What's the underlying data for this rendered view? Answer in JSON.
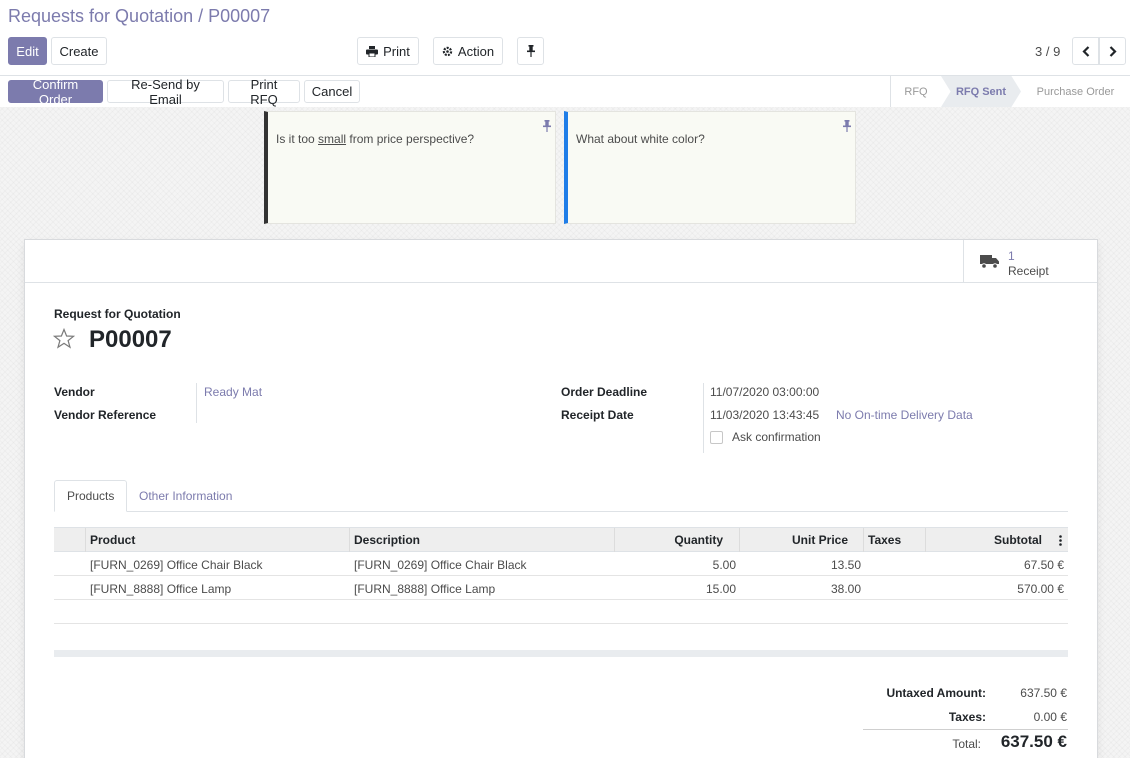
{
  "breadcrumb": {
    "parent": "Requests for Quotation",
    "separator": " / ",
    "current": "P00007"
  },
  "toolbar": {
    "edit": "Edit",
    "create": "Create",
    "print": "Print",
    "action": "Action"
  },
  "pager": {
    "value": "3 / 9"
  },
  "status_buttons": {
    "confirm": "Confirm Order",
    "resend": "Re-Send by Email",
    "print_rfq": "Print RFQ",
    "cancel": "Cancel"
  },
  "stages": [
    {
      "label": "RFQ",
      "active": false
    },
    {
      "label": "RFQ Sent",
      "active": true
    },
    {
      "label": "Purchase Order",
      "active": false
    }
  ],
  "notes": [
    {
      "before": "Is it too ",
      "underlined": "small",
      "after": " from price perspective?",
      "color": "#333333"
    },
    {
      "text": "What about white color?",
      "color": "#1f7de8"
    }
  ],
  "smart_button": {
    "value": "1",
    "label": "Receipt",
    "icon": "truck-icon"
  },
  "document": {
    "label": "Request for Quotation",
    "name": "P00007"
  },
  "fields": {
    "vendor_label": "Vendor",
    "vendor_value": "Ready Mat",
    "vendor_ref_label": "Vendor Reference",
    "order_deadline_label": "Order Deadline",
    "order_deadline_value": "11/07/2020 03:00:00",
    "receipt_date_label": "Receipt Date",
    "receipt_date_value": "11/03/2020 13:43:45",
    "delivery_data": "No On-time Delivery Data",
    "ask_confirmation": "Ask confirmation"
  },
  "tabs": [
    {
      "label": "Products",
      "active": true
    },
    {
      "label": "Other Information",
      "active": false
    }
  ],
  "table": {
    "headers": {
      "product": "Product",
      "description": "Description",
      "quantity": "Quantity",
      "unit_price": "Unit Price",
      "taxes": "Taxes",
      "subtotal": "Subtotal"
    },
    "rows": [
      {
        "product": "[FURN_0269] Office Chair Black",
        "description": "[FURN_0269] Office Chair Black",
        "quantity": "5.00",
        "unit_price": "13.50",
        "taxes": "",
        "subtotal": "67.50 €"
      },
      {
        "product": "[FURN_8888] Office Lamp",
        "description": "[FURN_8888] Office Lamp",
        "quantity": "15.00",
        "unit_price": "38.00",
        "taxes": "",
        "subtotal": "570.00 €"
      }
    ]
  },
  "totals": {
    "untaxed_label": "Untaxed Amount:",
    "untaxed_value": "637.50 €",
    "taxes_label": "Taxes:",
    "taxes_value": "0.00 €",
    "total_label": "Total:",
    "total_value": "637.50 €"
  },
  "colors": {
    "brand": "#7c7bad"
  }
}
